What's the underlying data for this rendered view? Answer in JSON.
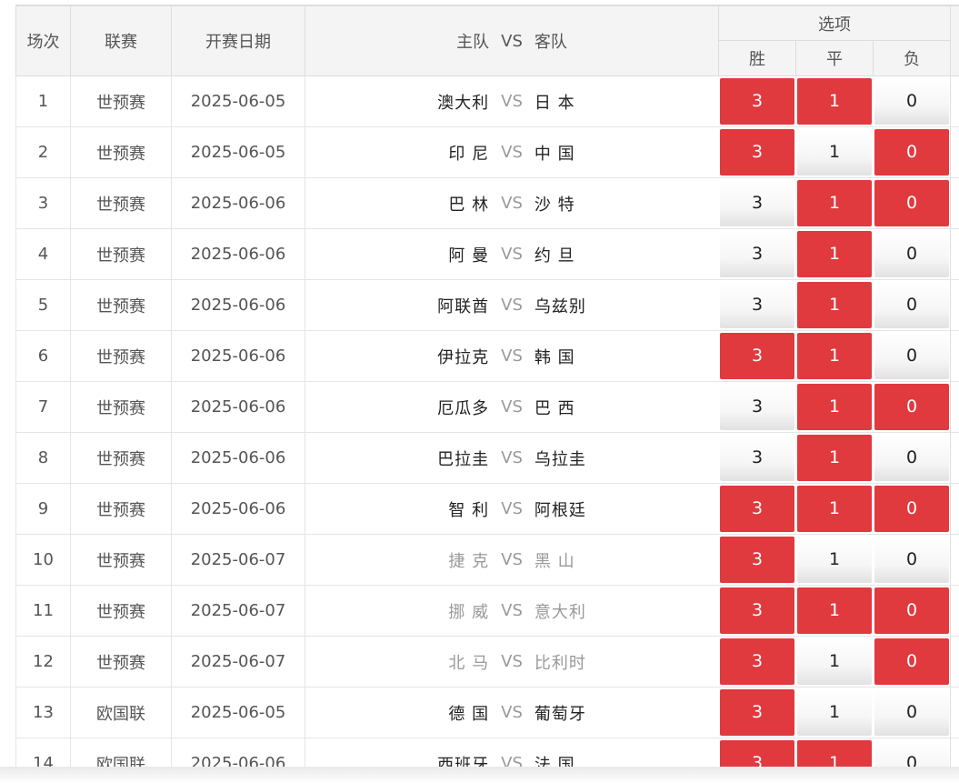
{
  "headers": {
    "no": "场次",
    "league": "联赛",
    "date": "开赛日期",
    "home": "主队",
    "vs": "VS",
    "away": "客队",
    "options": "选项",
    "win": "胜",
    "draw": "平",
    "lose": "负"
  },
  "option_values": {
    "win": "3",
    "draw": "1",
    "lose": "0"
  },
  "colors": {
    "selected": "#e0393e",
    "unselected": "#f4f4f4"
  },
  "rows": [
    {
      "no": "1",
      "league": "世预赛",
      "date": "2025-06-05",
      "home": "澳大利",
      "away": "日 本",
      "dim": false,
      "sel": [
        true,
        true,
        false
      ]
    },
    {
      "no": "2",
      "league": "世预赛",
      "date": "2025-06-05",
      "home": "印 尼",
      "away": "中 国",
      "dim": false,
      "sel": [
        true,
        false,
        true
      ]
    },
    {
      "no": "3",
      "league": "世预赛",
      "date": "2025-06-06",
      "home": "巴 林",
      "away": "沙 特",
      "dim": false,
      "sel": [
        false,
        true,
        true
      ]
    },
    {
      "no": "4",
      "league": "世预赛",
      "date": "2025-06-06",
      "home": "阿 曼",
      "away": "约 旦",
      "dim": false,
      "sel": [
        false,
        true,
        false
      ]
    },
    {
      "no": "5",
      "league": "世预赛",
      "date": "2025-06-06",
      "home": "阿联酋",
      "away": "乌兹别",
      "dim": false,
      "sel": [
        false,
        true,
        false
      ]
    },
    {
      "no": "6",
      "league": "世预赛",
      "date": "2025-06-06",
      "home": "伊拉克",
      "away": "韩 国",
      "dim": false,
      "sel": [
        true,
        true,
        false
      ]
    },
    {
      "no": "7",
      "league": "世预赛",
      "date": "2025-06-06",
      "home": "厄瓜多",
      "away": "巴 西",
      "dim": false,
      "sel": [
        false,
        true,
        true
      ]
    },
    {
      "no": "8",
      "league": "世预赛",
      "date": "2025-06-06",
      "home": "巴拉圭",
      "away": "乌拉圭",
      "dim": false,
      "sel": [
        false,
        true,
        false
      ]
    },
    {
      "no": "9",
      "league": "世预赛",
      "date": "2025-06-06",
      "home": "智 利",
      "away": "阿根廷",
      "dim": false,
      "sel": [
        true,
        true,
        true
      ]
    },
    {
      "no": "10",
      "league": "世预赛",
      "date": "2025-06-07",
      "home": "捷 克",
      "away": "黑 山",
      "dim": true,
      "sel": [
        true,
        false,
        false
      ]
    },
    {
      "no": "11",
      "league": "世预赛",
      "date": "2025-06-07",
      "home": "挪 威",
      "away": "意大利",
      "dim": true,
      "sel": [
        true,
        true,
        true
      ]
    },
    {
      "no": "12",
      "league": "世预赛",
      "date": "2025-06-07",
      "home": "北 马",
      "away": "比利时",
      "dim": true,
      "sel": [
        true,
        false,
        true
      ]
    },
    {
      "no": "13",
      "league": "欧国联",
      "date": "2025-06-05",
      "home": "德 国",
      "away": "葡萄牙",
      "dim": false,
      "sel": [
        true,
        false,
        false
      ]
    },
    {
      "no": "14",
      "league": "欧国联",
      "date": "2025-06-06",
      "home": "西班牙",
      "away": "法 国",
      "dim": false,
      "sel": [
        true,
        true,
        false
      ]
    }
  ]
}
